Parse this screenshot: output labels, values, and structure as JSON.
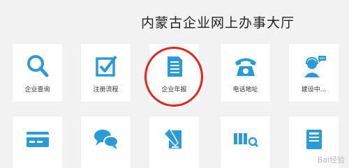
{
  "page": {
    "title": "内蒙古企业网上办事大厅"
  },
  "tiles_row1": [
    {
      "label": "企业查询",
      "icon": "search-icon"
    },
    {
      "label": "注册流程",
      "icon": "checkbox-icon"
    },
    {
      "label": "企业年报",
      "icon": "document-icon"
    },
    {
      "label": "电话地址",
      "icon": "telephone-icon"
    },
    {
      "label": "建设中...",
      "icon": "customer-service-icon"
    }
  ],
  "tiles_row2": [
    {
      "icon": "card-icon"
    },
    {
      "icon": "chat-bubbles-icon"
    },
    {
      "icon": "note-pen-icon"
    },
    {
      "icon": "barcode-search-icon"
    },
    {
      "icon": "book-icon"
    }
  ],
  "watermark": "Bai经验",
  "colors": {
    "accent": "#2a9bd6",
    "highlight_circle": "#e0261f",
    "background": "#f2f2f2"
  }
}
